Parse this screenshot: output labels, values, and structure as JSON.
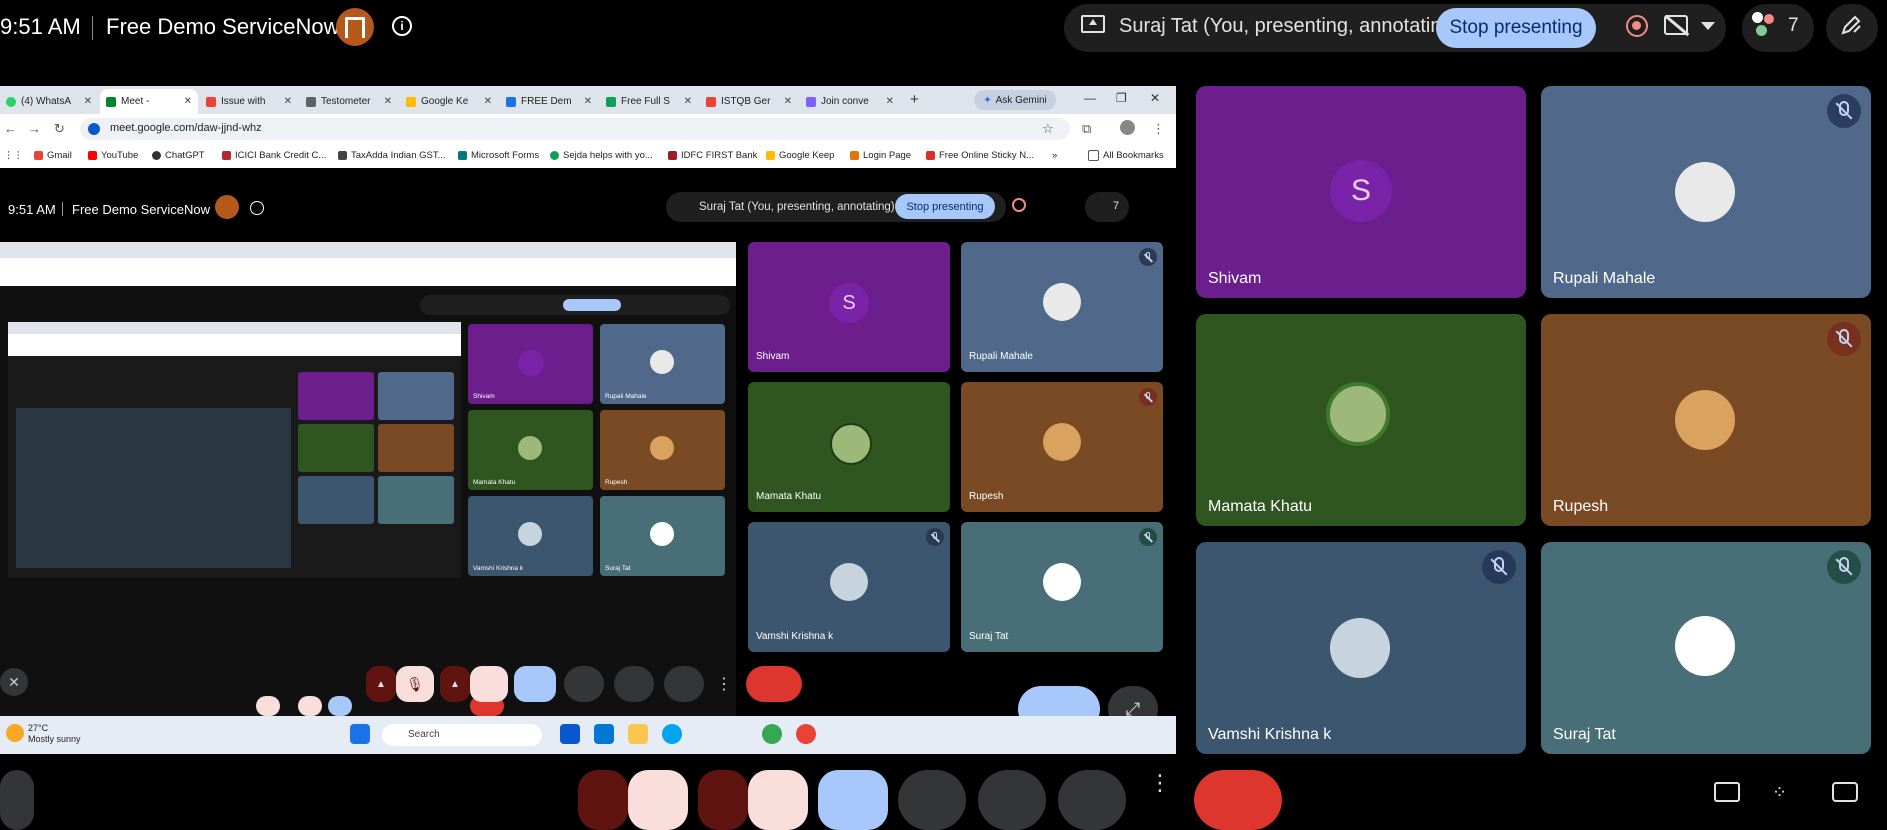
{
  "header": {
    "time": "9:51 AM",
    "meeting_title": "Free Demo ServiceNow",
    "presenting_status": "Suraj Tat (You, presenting, annotating)",
    "stop_presenting_label": "Stop presenting",
    "participant_count": "7",
    "icons": [
      "host-badge-icon",
      "info-icon",
      "present-screen-icon",
      "record-icon",
      "captions-off-icon",
      "chevron-down-icon",
      "people-icon",
      "annotate-pencil-icon"
    ]
  },
  "browser": {
    "tabs": [
      {
        "label": "(4) WhatsA",
        "color": "#25d366"
      },
      {
        "label": "Meet -",
        "color": "#00832d",
        "active": true
      },
      {
        "label": "Issue with",
        "color": "#ea4335"
      },
      {
        "label": "Testometer",
        "color": "#5f6368"
      },
      {
        "label": "Google Ke",
        "color": "#fbbc04"
      },
      {
        "label": "FREE Dem",
        "color": "#1a73e8"
      },
      {
        "label": "Free Full S",
        "color": "#0f9d58"
      },
      {
        "label": "ISTQB Ger",
        "color": "#ea4335"
      },
      {
        "label": "Join conve",
        "color": "#7b61ff"
      }
    ],
    "ask_gemini_label": "Ask Gemini",
    "url": "meet.google.com/daw-jjnd-whz",
    "bookmarks": [
      {
        "label": "Gmail",
        "color": "#ea4335"
      },
      {
        "label": "YouTube",
        "color": "#ff0000"
      },
      {
        "label": "ChatGPT",
        "color": "#333333"
      },
      {
        "label": "ICICI Bank Credit C...",
        "color": "#b02a30"
      },
      {
        "label": "TaxAdda Indian GST...",
        "color": "#444444"
      },
      {
        "label": "Microsoft Forms",
        "color": "#03787c"
      },
      {
        "label": "Sejda helps with yo...",
        "color": "#0f9d58"
      },
      {
        "label": "IDFC FIRST Bank",
        "color": "#9c1d26"
      },
      {
        "label": "Google Keep",
        "color": "#fbbc04"
      },
      {
        "label": "Login Page",
        "color": "#e37400"
      },
      {
        "label": "Free Online Sticky N...",
        "color": "#d93025"
      }
    ],
    "all_bookmarks_label": "All Bookmarks"
  },
  "inner_meet": {
    "time": "9:51 AM",
    "meeting_title": "Free Demo ServiceNow",
    "presenting_status": "Suraj Tat (You, presenting, annotating)",
    "stop_presenting_label": "Stop presenting",
    "participant_count": "7"
  },
  "participants": [
    {
      "name": "Shivam",
      "initial": "S",
      "tile_color": "#6b1e8c",
      "avatar_color": "#7b23a8",
      "muted": false
    },
    {
      "name": "Rupali Mahale",
      "initial": "",
      "tile_color": "#50698a",
      "avatar_color": "#e9e9e9",
      "muted": true
    },
    {
      "name": "Mamata Khatu",
      "initial": "",
      "tile_color": "#2f5520",
      "avatar_color": "#9db97a",
      "muted": false
    },
    {
      "name": "Rupesh",
      "initial": "",
      "tile_color": "#7a4a24",
      "avatar_color": "#d9a25f",
      "muted": true
    },
    {
      "name": "Vamshi Krishna k",
      "initial": "",
      "tile_color": "#3c5670",
      "avatar_color": "#c8d4dd",
      "muted": true
    },
    {
      "name": "Suraj Tat",
      "initial": "",
      "tile_color": "#486f77",
      "avatar_color": "#ffffff",
      "muted": true
    }
  ],
  "taskbar": {
    "temperature": "27°C",
    "weather": "Mostly sunny",
    "search_placeholder": "Search"
  }
}
